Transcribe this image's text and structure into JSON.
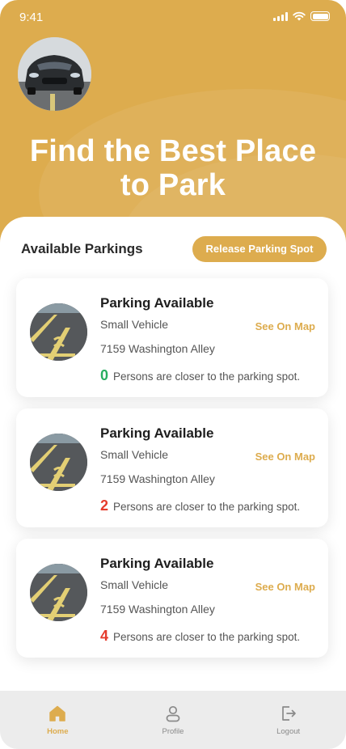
{
  "status_bar": {
    "time": "9:41"
  },
  "hero": {
    "title_line1": "Find the Best Place",
    "title_line2": "to Park"
  },
  "section": {
    "title": "Available Parkings",
    "release_button_label": "Release Parking Spot"
  },
  "cards": [
    {
      "title": "Parking Available",
      "vehicle": "Small Vehicle",
      "address": "7159 Washington Alley",
      "map_link": "See On Map",
      "count": "0",
      "count_color": "#27ae60",
      "count_text": "Persons are closer to the parking spot."
    },
    {
      "title": "Parking Available",
      "vehicle": "Small Vehicle",
      "address": "7159 Washington Alley",
      "map_link": "See On Map",
      "count": "2",
      "count_color": "#e53b2c",
      "count_text": "Persons are closer to the parking spot."
    },
    {
      "title": "Parking Available",
      "vehicle": "Small Vehicle",
      "address": "7159 Washington Alley",
      "map_link": "See On Map",
      "count": "4",
      "count_color": "#e53b2c",
      "count_text": "Persons are closer to the parking spot."
    }
  ],
  "nav": {
    "items": [
      {
        "label": "Home",
        "icon": "home-icon",
        "active": true
      },
      {
        "label": "Profile",
        "icon": "profile-icon",
        "active": false
      },
      {
        "label": "Logout",
        "icon": "logout-icon",
        "active": false
      }
    ]
  },
  "colors": {
    "accent": "#DDAC4E",
    "count_zero": "#27ae60",
    "count_nonzero": "#e53b2c"
  }
}
